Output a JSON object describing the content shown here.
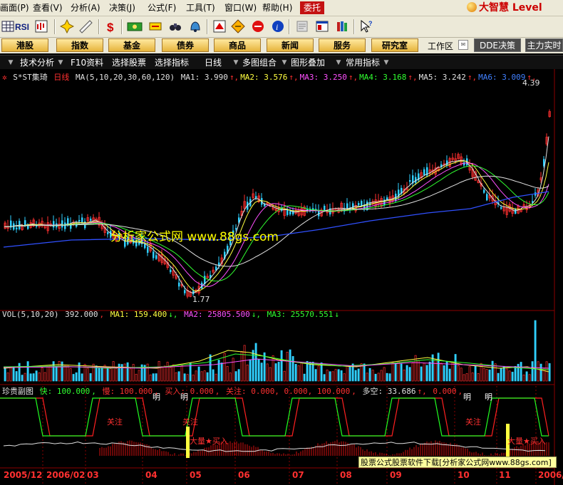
{
  "menu": {
    "items": [
      "画面(P)",
      "查看(V)",
      "分析(A)",
      "决策(J)",
      "公式(F)",
      "工具(T)",
      "窗口(W)",
      "帮助(H)"
    ],
    "entrust": "委托",
    "brand": "大智慧 Level"
  },
  "quicknav": {
    "buttons": [
      "港股",
      "指数",
      "基金",
      "债券",
      "商品",
      "新闻",
      "服务",
      "研究室"
    ],
    "workarea_label": "工作区",
    "dde_label": "DDE决策",
    "main_force_label": "主力实时"
  },
  "functabs": [
    "技术分析",
    "F10资料",
    "选择股票",
    "选择指标",
    "日线",
    "多图组合",
    "图形叠加",
    "常用指标"
  ],
  "price_panel": {
    "stock_name": "S*ST集琦",
    "period": "日线",
    "ma_label": "MA(5,10,20,30,60,120)",
    "ma_values": [
      {
        "name": "MA1:",
        "value": "3.990",
        "color": "#e0e0e0"
      },
      {
        "name": "MA2:",
        "value": "3.576",
        "color": "#ffff40"
      },
      {
        "name": "MA3:",
        "value": "3.250",
        "color": "#ff50ff"
      },
      {
        "name": "MA4:",
        "value": "3.168",
        "color": "#30ff30"
      },
      {
        "name": "MA5:",
        "value": "3.242",
        "color": "#e0e0e0"
      },
      {
        "name": "MA6:",
        "value": "3.009",
        "color": "#4080ff"
      }
    ],
    "low_label": "1.77",
    "high_label": "4.39"
  },
  "vol_panel": {
    "label": "VOL(5,10,20)",
    "value": "392.000",
    "ma1": "MA1: 159.400",
    "ma2": "MA2: 25805.500",
    "ma3": "MA3: 25570.551"
  },
  "indicator_panel": {
    "name": "珍贵副图",
    "fast": "快: 100.000",
    "slow": "慢: 100.000",
    "buy": "买入: 0.000",
    "watch": "关注: 0.000, 0.000, 100.000",
    "long_short": "多空: 33.686",
    "last": "0.000",
    "annotations": {
      "ming": "明",
      "guanzhu": "关注",
      "big_buy": "大量★买入"
    }
  },
  "watermark": "分析家公式网 www.88gs.com",
  "footer_banner": "股票公式股票软件下载[分析家公式网www.88gs.com]",
  "x_axis": [
    "2005/12",
    "2006/02",
    "03",
    "04",
    "05",
    "06",
    "07",
    "08",
    "09",
    "10",
    "11",
    "2006/12"
  ],
  "colors": {
    "candle_up": "#ff3030",
    "candle_down": "#30d0ff",
    "ma_white": "#e0e0e0",
    "ma_yellow": "#ffff40",
    "ma_magenta": "#ff50ff",
    "ma_green": "#30ff30",
    "ma_blue": "#3050ff",
    "grid": "#8b0000"
  }
}
